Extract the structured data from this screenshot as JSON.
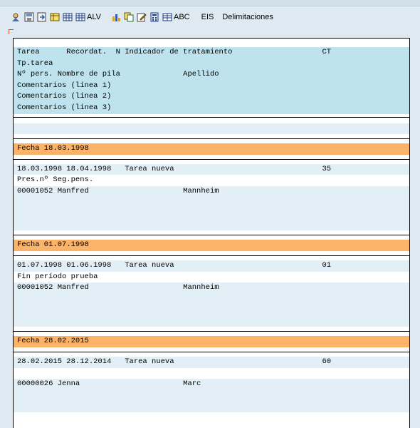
{
  "toolbar": {
    "icons": [
      "person-search-icon",
      "save-icon",
      "export-icon",
      "table-yellow-icon",
      "table-grid-icon",
      "alv-grid-icon",
      "chart-icon",
      "copy-icon",
      "edit-icon",
      "calculator-icon",
      "abc-icon"
    ],
    "alv_label": "ALV",
    "abc_label": "ABC",
    "eis_label": "EIS",
    "delimitaciones_label": "Delimitaciones"
  },
  "header": {
    "line1": "Tarea      Recordat.  N Indicador de tratamiento                    CT",
    "line2": "Tp.tarea",
    "line3": "Nº pers. Nombre de pila              Apellido",
    "line4": "Comentarios (línea 1)",
    "line5": "Comentarios (línea 2)",
    "line6": "Comentarios (línea 3)"
  },
  "groups": [
    {
      "date_label": "Fecha 18.03.1998",
      "line1": "18.03.1998 18.04.1998   Tarea nueva                                 35",
      "line2": "Pres.nº Seg.pens.",
      "line3": "00001052 Manfred                     Mannheim"
    },
    {
      "date_label": "Fecha 01.07.1998",
      "line1": "01.07.1998 01.06.1998   Tarea nueva                                 01",
      "line2": "Fin período prueba",
      "line3": "00001052 Manfred                     Mannheim"
    },
    {
      "date_label": "Fecha 28.02.2015",
      "line1": "28.02.2015 28.12.2014   Tarea nueva                                 60",
      "line2": "",
      "line3": "00000026 Jenna                       Marc"
    }
  ]
}
